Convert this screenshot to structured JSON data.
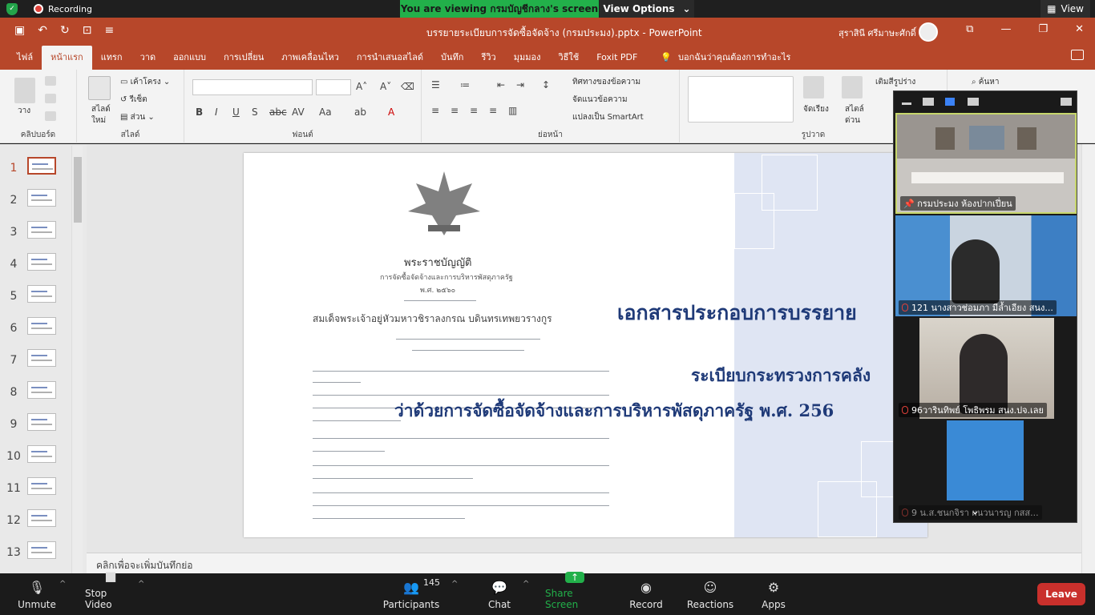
{
  "zoom": {
    "recording_label": "Recording",
    "share_banner": "You are viewing กรมบัญชีกลาง's screen",
    "view_options_label": "View Options",
    "view_label": "View"
  },
  "app": {
    "doc_title": "บรรยายระเบียบการจัดซื้อจัดจ้าง (กรมประมง).pptx  -  PowerPoint",
    "user_name": "สุราสินี ศรีมาษะศักดิ์"
  },
  "tabs": [
    "ไฟล์",
    "หน้าแรก",
    "แทรก",
    "วาด",
    "ออกแบบ",
    "การเปลี่ยน",
    "ภาพเคลื่อนไหว",
    "การนำเสนอสไลด์",
    "บันทึก",
    "รีวิว",
    "มุมมอง",
    "วิธีใช้",
    "Foxit PDF"
  ],
  "tell_me": "บอกฉันว่าคุณต้องการทำอะไร",
  "ribbon": {
    "clipboard_label": "คลิปบอร์ด",
    "paste_label": "วาง",
    "slides_label": "สไลด์",
    "new_slide_label": "สไลด์",
    "new_slide_sub": "ใหม่",
    "layout_label": "เค้าโครง",
    "reset_label": "รีเซ็ต",
    "section_label": "ส่วน",
    "font_label": "ฟอนต์",
    "paragraph_label": "ย่อหน้า",
    "text_direction": "ทิศทางของข้อความ",
    "align_text": "จัดแนวข้อความ",
    "smartart": "แปลงเป็น SmartArt",
    "drawing_label": "รูปวาด",
    "arrange_label": "จัดเรียง",
    "quick_styles_1": "สไตล์",
    "quick_styles_2": "ด่วน",
    "find_label": "ค้นหา",
    "replace_label": "เติมสีรูปร่าง"
  },
  "slide_numbers": [
    "1",
    "2",
    "3",
    "4",
    "5",
    "6",
    "7",
    "8",
    "9",
    "10",
    "11",
    "12",
    "13"
  ],
  "slide": {
    "heading": "เอกสารประกอบการบรรยาย",
    "sub1": "ระเบียบกระทรวงการคลัง",
    "sub2": "ว่าด้วยการจัดซื้อจัดจ้างและการบริหารพัสดุภาครัฐ พ.ศ. 256",
    "doc_title": "พระราชบัญญัติ",
    "doc_sub": "การจัดซื้อจัดจ้างและการบริหารพัสดุภาครัฐ",
    "doc_year": "พ.ศ. ๒๕๖๐",
    "doc_king": "สมเด็จพระเจ้าอยู่หัวมหาวชิราลงกรณ  บดินทรเทพยวรางกูร"
  },
  "notes_placeholder": "คลิกเพื่อจะเพิ่มบันทึกย่อ",
  "gallery": {
    "participants": [
      "กรมประมง ห้องปากเปี่ยน",
      "121 นางสาวช่อมภา  มีล้ำเอียง สนง...",
      "96วารินทิพย์ โพธิพรม สนง.ปจ.เลย",
      "9 น.ส.ชนกจิรา ผนวนารญ กสส..."
    ]
  },
  "toolbar": {
    "unmute": "Unmute",
    "stop_video": "Stop Video",
    "participants": "Participants",
    "participant_count": "145",
    "chat": "Chat",
    "share_screen": "Share Screen",
    "record": "Record",
    "reactions": "Reactions",
    "apps": "Apps",
    "leave": "Leave"
  },
  "colors": {
    "powerpoint_accent": "#b7472a",
    "zoom_green": "#22b04a",
    "leave_red": "#c9302c",
    "slide_text": "#1f3a78"
  }
}
